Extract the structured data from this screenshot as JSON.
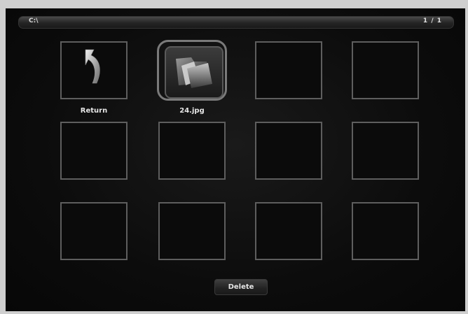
{
  "header": {
    "path": "C:\\",
    "page_indicator": "1 / 1"
  },
  "grid": {
    "items": [
      {
        "label": "Return",
        "icon": "return-arrow-icon"
      },
      {
        "label": "24.jpg",
        "icon": "folder-icon",
        "selected": true
      },
      {
        "label": ""
      },
      {
        "label": ""
      },
      {
        "label": ""
      },
      {
        "label": ""
      },
      {
        "label": ""
      },
      {
        "label": ""
      },
      {
        "label": ""
      },
      {
        "label": ""
      },
      {
        "label": ""
      },
      {
        "label": ""
      }
    ]
  },
  "actions": {
    "delete_label": "Delete"
  }
}
